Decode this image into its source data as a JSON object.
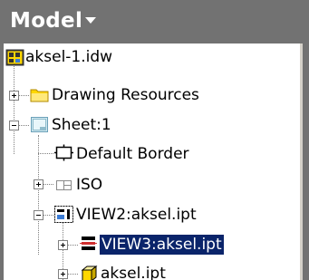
{
  "panel": {
    "title": "Model",
    "colors": {
      "header": "#727272",
      "selection": "#0a246a",
      "folder": "#ffd700"
    }
  },
  "tree": {
    "items": [
      {
        "label": "aksel-1.idw",
        "icon": "drawing-document-icon",
        "expander": "none"
      },
      {
        "label": "Drawing Resources",
        "icon": "folder-icon",
        "expander": "collapsed"
      },
      {
        "label": "Sheet:1",
        "icon": "sheet-icon",
        "expander": "expanded"
      },
      {
        "label": "Default Border",
        "icon": "border-icon",
        "expander": "none"
      },
      {
        "label": "ISO",
        "icon": "title-block-icon",
        "expander": "collapsed"
      },
      {
        "label": "VIEW2:aksel.ipt",
        "icon": "drawing-view-icon",
        "expander": "expanded"
      },
      {
        "label": "VIEW3:aksel.ipt",
        "icon": "section-view-icon",
        "expander": "collapsed",
        "selected": true
      },
      {
        "label": "aksel.ipt",
        "icon": "part-icon",
        "expander": "collapsed"
      }
    ]
  }
}
